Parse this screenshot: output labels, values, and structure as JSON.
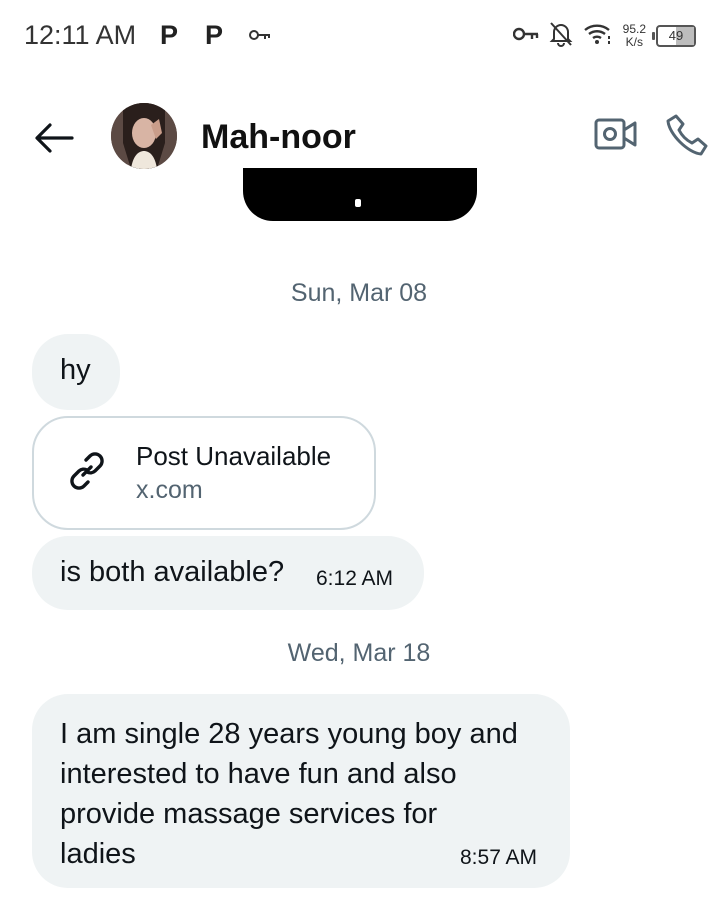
{
  "status_bar": {
    "time": "12:11 AM",
    "notif_icons": [
      "P",
      "P"
    ],
    "net_speed_value": "95.2",
    "net_speed_unit": "K/s",
    "battery": "49",
    "battery_level": 0.49
  },
  "header": {
    "contact_name": "Mah-noor"
  },
  "messages": [
    {
      "date_separator": "Sun, Mar 08"
    },
    {
      "text": "hy"
    },
    {
      "link_title": "Post Unavailable",
      "link_domain": "x.com"
    },
    {
      "text": "is both available?",
      "time": "6:12 AM"
    },
    {
      "date_separator": "Wed, Mar 18"
    },
    {
      "text_lines": [
        "I am single 28 years young boy and",
        "interested to have fun and also",
        "provide massage services for",
        "ladies"
      ],
      "time": "8:57 AM"
    }
  ],
  "colors": {
    "bubble_bg": "#eff3f4",
    "secondary_text": "#536471",
    "border": "#cfd9de"
  }
}
